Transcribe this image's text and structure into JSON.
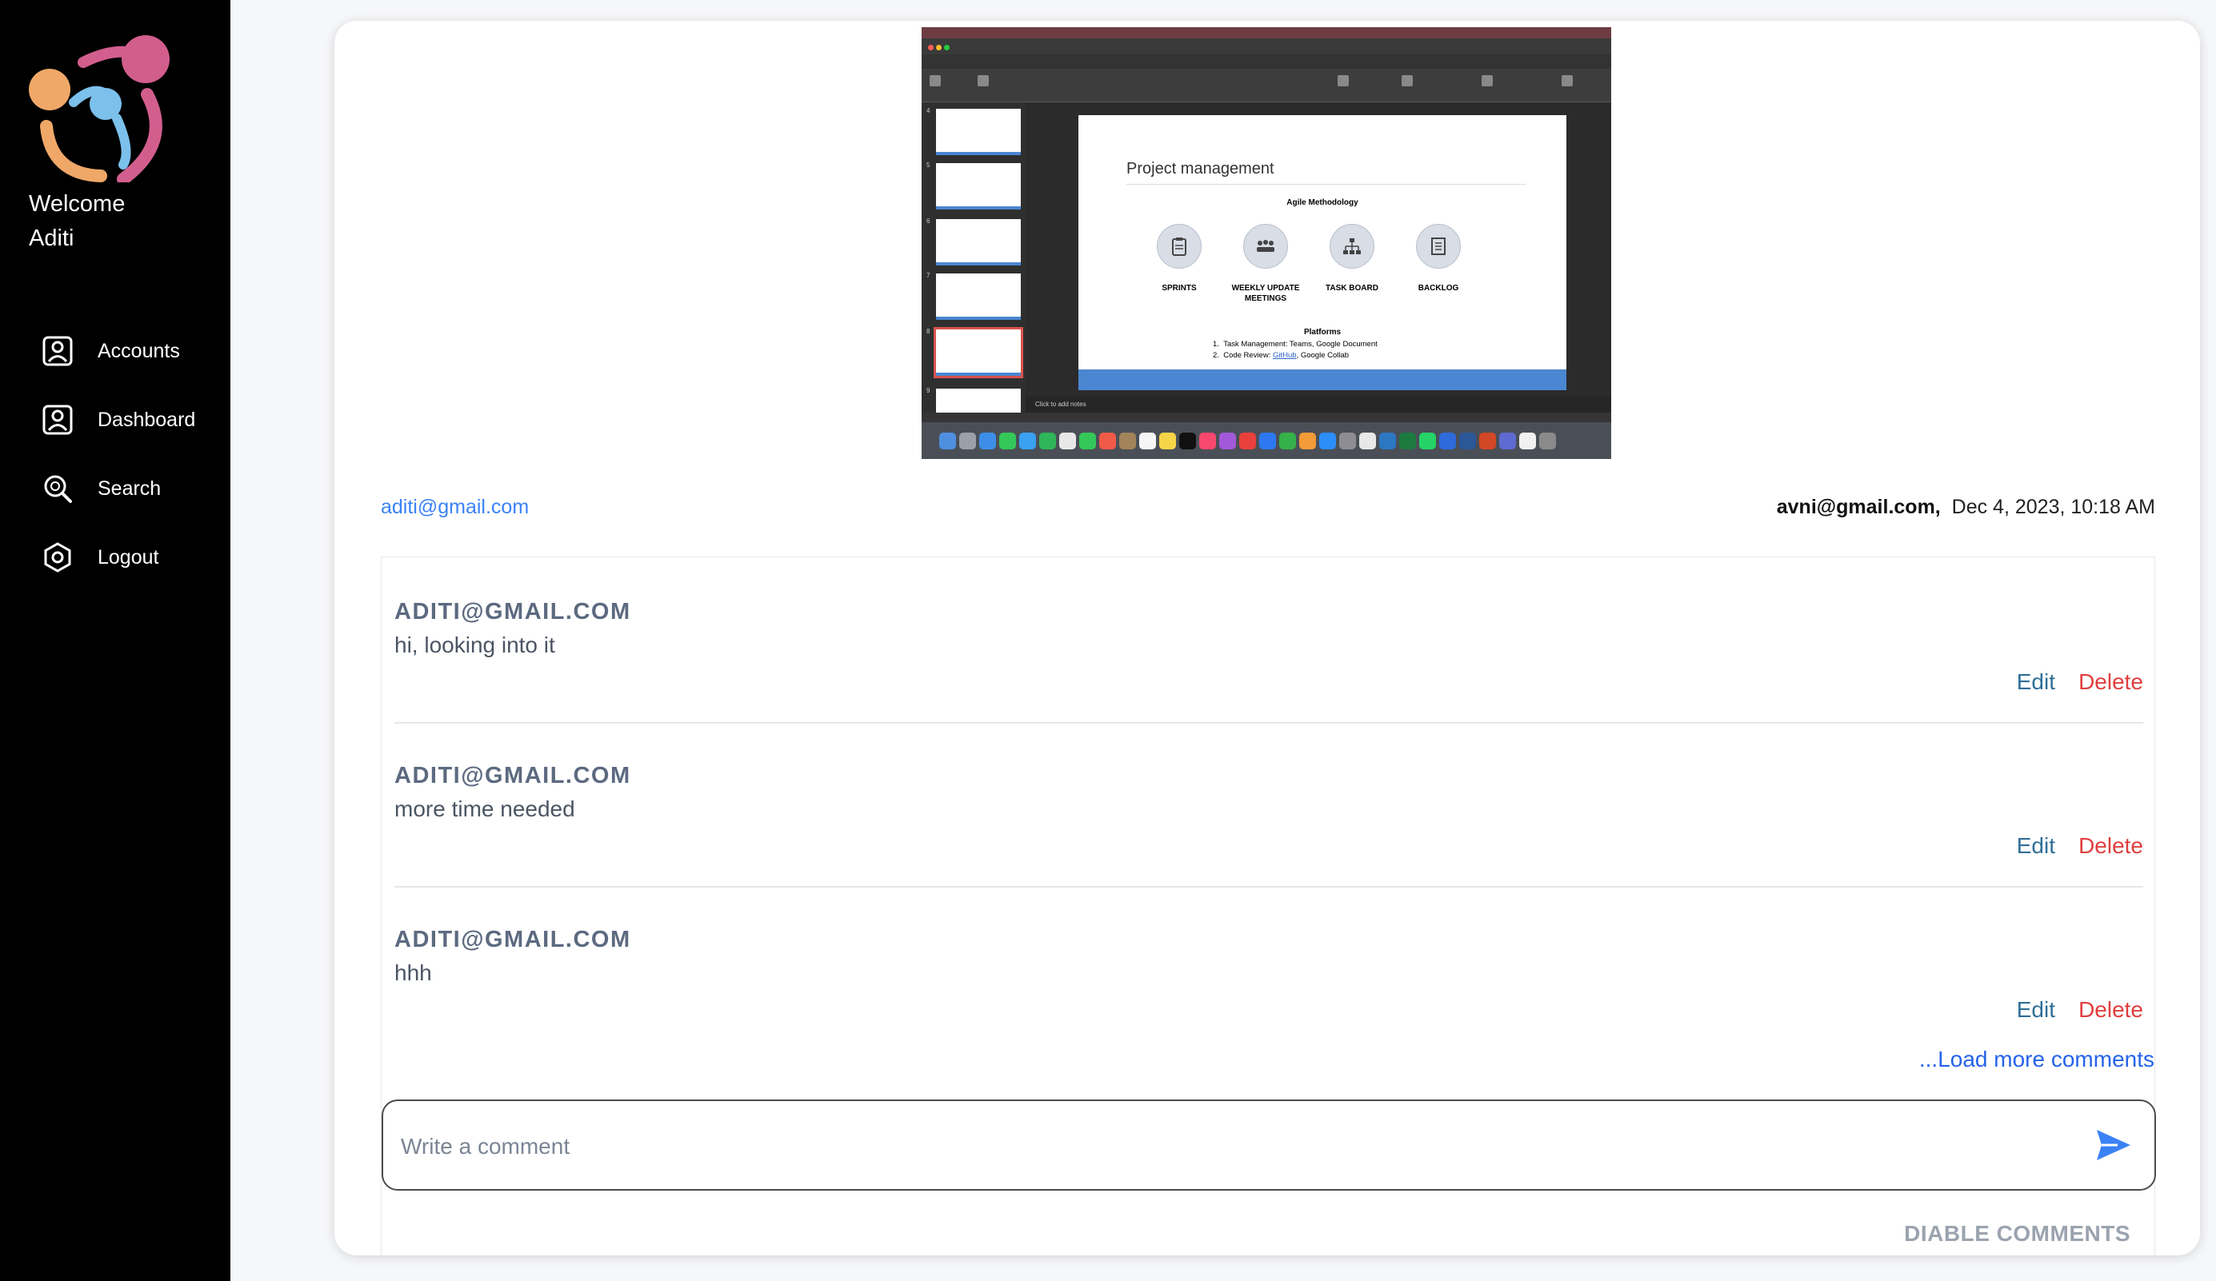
{
  "sidebar": {
    "welcome_line1": "Welcome",
    "welcome_line2": "Aditi",
    "items": [
      {
        "label": "Accounts",
        "icon": "account-box-icon"
      },
      {
        "label": "Dashboard",
        "icon": "account-box-icon"
      },
      {
        "label": "Search",
        "icon": "search-icon"
      },
      {
        "label": "Logout",
        "icon": "logout-hexagon-icon"
      }
    ]
  },
  "post": {
    "attachment": {
      "slide_title": "Project management",
      "subtitle": "Agile Methodology",
      "items": [
        "SPRINTS",
        "WEEKLY UPDATE MEETINGS",
        "TASK BOARD",
        "BACKLOG"
      ],
      "platforms_heading": "Platforms",
      "platform_1": "Task Management: Teams, Google Document",
      "platform_2_prefix": "Code Review: ",
      "platform_2_link": "GitHub",
      "platform_2_suffix": ", Google Collab",
      "notes_placeholder": "Click to add notes"
    },
    "poster_email": "aditi@gmail.com",
    "assignee_email": "avni@gmail.com,",
    "timestamp": "Dec 4, 2023, 10:18 AM"
  },
  "comments": [
    {
      "author": "ADITI@GMAIL.COM",
      "text": "hi, looking into it",
      "edit": "Edit",
      "delete": "Delete"
    },
    {
      "author": "ADITI@GMAIL.COM",
      "text": "more time needed",
      "edit": "Edit",
      "delete": "Delete"
    },
    {
      "author": "ADITI@GMAIL.COM",
      "text": "hhh",
      "edit": "Edit",
      "delete": "Delete"
    }
  ],
  "load_more": "...Load more comments",
  "comment_input": {
    "placeholder": "Write a comment",
    "value": ""
  },
  "disable_button": "DIABLE COMMENTS",
  "colors": {
    "sidebar_bg": "#000000",
    "link": "#3b82f6",
    "edit": "#2f6e97",
    "delete": "#e03e3e",
    "author": "#5c6a80"
  }
}
